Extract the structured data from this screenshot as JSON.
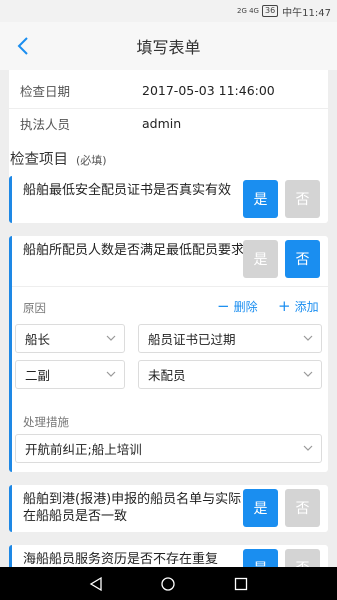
{
  "status_bar": {
    "signal": "2G 4G",
    "battery": "36",
    "time": "中午11:47"
  },
  "header": {
    "title": "填写表单"
  },
  "info": {
    "rows": [
      {
        "label": "检查日期",
        "value": "2017-05-03 11:46:00"
      },
      {
        "label": "执法人员",
        "value": "admin"
      }
    ]
  },
  "section": {
    "title": "检查项目",
    "required": "(必填)"
  },
  "questions": [
    {
      "text": "船舶最低安全配员证书是否真实有效",
      "yes": "是",
      "no": "否",
      "selected": "yes"
    },
    {
      "text": "船舶所配员人数是否满足最低配员要求",
      "yes": "是",
      "no": "否",
      "selected": "no"
    },
    {
      "text": "船舶到港(报港)申报的船员名单与实际在船船员是否一致",
      "yes": "是",
      "no": "否",
      "selected": "yes"
    },
    {
      "text": "海船船员服务资历是否不存在重复",
      "yes": "是",
      "no": "否",
      "selected": "yes"
    }
  ],
  "reason": {
    "label": "原因",
    "delete_label": "删除",
    "add_label": "添加",
    "rows": [
      {
        "position": "船长",
        "reason": "船员证书已过期"
      },
      {
        "position": "二副",
        "reason": "未配员"
      }
    ]
  },
  "measure": {
    "label": "处理措施",
    "value": "开航前纠正;船上培训"
  },
  "colors": {
    "accent": "#1a8ef0",
    "inactive": "#d4d4d4"
  }
}
